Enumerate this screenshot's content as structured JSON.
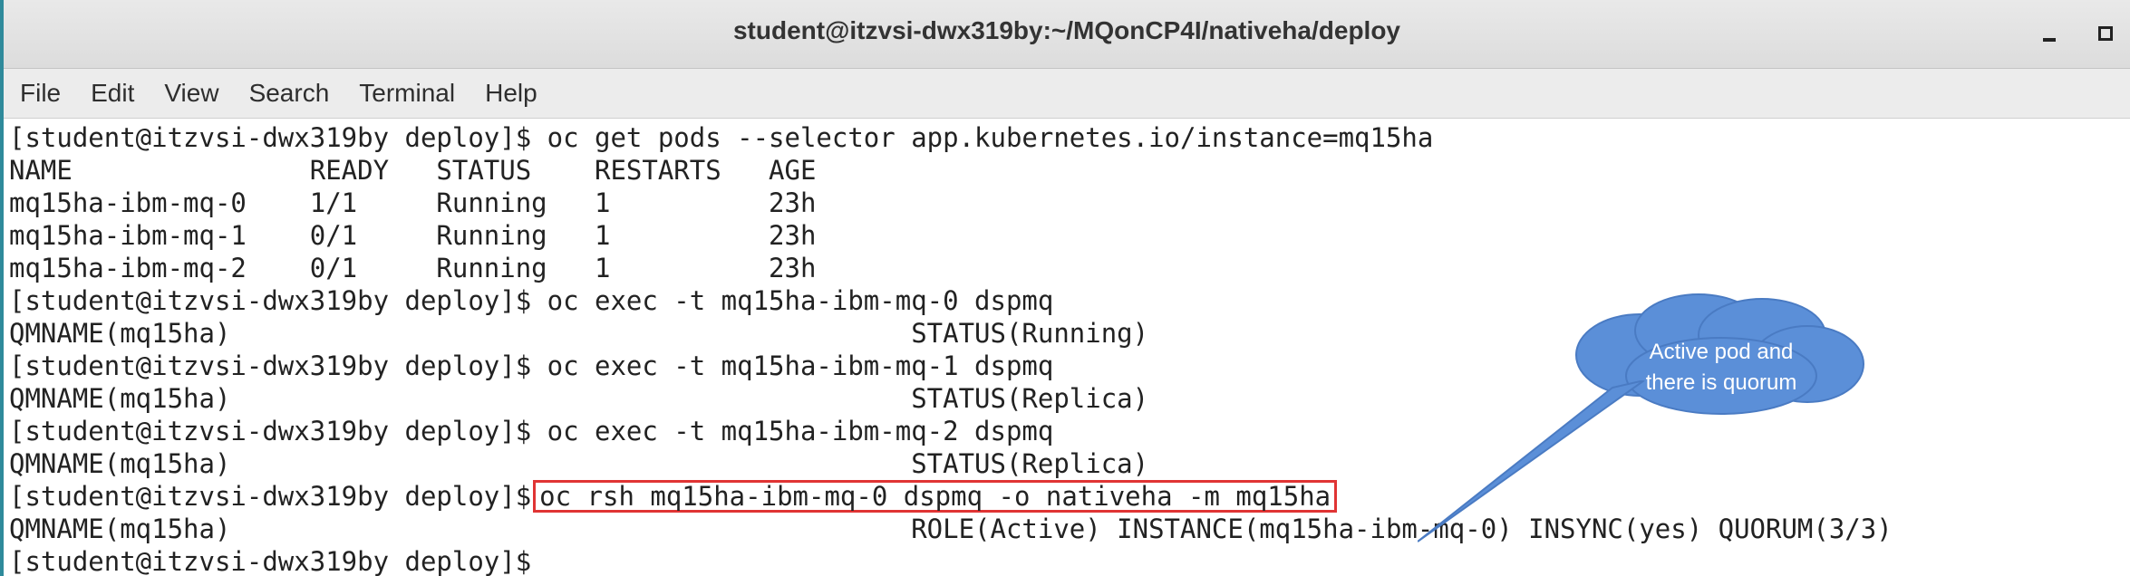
{
  "window": {
    "title": "student@itzvsi-dwx319by:~/MQonCP4I/nativeha/deploy"
  },
  "menu": [
    "File",
    "Edit",
    "View",
    "Search",
    "Terminal",
    "Help"
  ],
  "terminal": {
    "lines": [
      "[student@itzvsi-dwx319by deploy]$ oc get pods --selector app.kubernetes.io/instance=mq15ha",
      "NAME               READY   STATUS    RESTARTS   AGE",
      "mq15ha-ibm-mq-0    1/1     Running   1          23h",
      "mq15ha-ibm-mq-1    0/1     Running   1          23h",
      "mq15ha-ibm-mq-2    0/1     Running   1          23h",
      "[student@itzvsi-dwx319by deploy]$ oc exec -t mq15ha-ibm-mq-0 dspmq",
      "QMNAME(mq15ha)                                           STATUS(Running)",
      "[student@itzvsi-dwx319by deploy]$ oc exec -t mq15ha-ibm-mq-1 dspmq",
      "QMNAME(mq15ha)                                           STATUS(Replica)",
      "[student@itzvsi-dwx319by deploy]$ oc exec -t mq15ha-ibm-mq-2 dspmq",
      "QMNAME(mq15ha)                                           STATUS(Replica)"
    ],
    "highlight_prompt": "[student@itzvsi-dwx319by deploy]$",
    "highlight_command": "oc rsh mq15ha-ibm-mq-0 dspmq -o nativeha -m mq15ha",
    "result_line": "QMNAME(mq15ha)                                           ROLE(Active) INSTANCE(mq15ha-ibm-mq-0) INSYNC(yes) QUORUM(3/3)",
    "final_prompt": "[student@itzvsi-dwx319by deploy]$"
  },
  "callout": {
    "line1": "Active pod and",
    "line2": "there is quorum",
    "color": "#5b8fd8"
  }
}
